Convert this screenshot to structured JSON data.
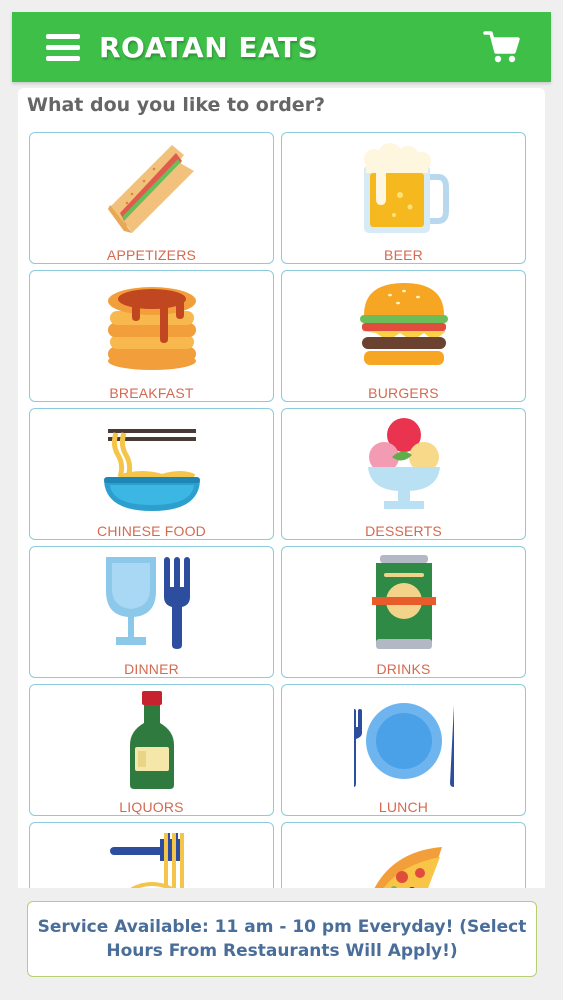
{
  "header": {
    "title": "ROATAN EATS",
    "menu_icon": "hamburger-menu-icon",
    "cart_icon": "shopping-cart-icon",
    "bar_color": "#3dbf48"
  },
  "main": {
    "prompt": "What dou you like to  order?",
    "categories": [
      {
        "label": "APPETIZERS",
        "icon": "sandwich-icon"
      },
      {
        "label": "BEER",
        "icon": "beer-mug-icon"
      },
      {
        "label": "BREAKFAST",
        "icon": "pancakes-icon"
      },
      {
        "label": "BURGERS",
        "icon": "burger-icon"
      },
      {
        "label": "CHINESE FOOD",
        "icon": "noodle-bowl-icon"
      },
      {
        "label": "DESSERTS",
        "icon": "ice-cream-icon"
      },
      {
        "label": "DINNER",
        "icon": "wine-glass-fork-icon"
      },
      {
        "label": "DRINKS",
        "icon": "soda-can-icon"
      },
      {
        "label": "LIQUORS",
        "icon": "liquor-bottle-icon"
      },
      {
        "label": "LUNCH",
        "icon": "plate-cutlery-icon"
      },
      {
        "label": "",
        "icon": "pasta-fork-icon"
      },
      {
        "label": "",
        "icon": "pizza-slice-icon"
      }
    ]
  },
  "footer": {
    "notice": "Service Available: 11 am - 10 pm Everyday! (Select Hours From Restaurants Will Apply!)"
  },
  "colors": {
    "tile_border": "#8ccbdc",
    "label_text": "#d46a50",
    "notice_text": "#4a6e9a",
    "notice_border": "#b7cf73"
  }
}
